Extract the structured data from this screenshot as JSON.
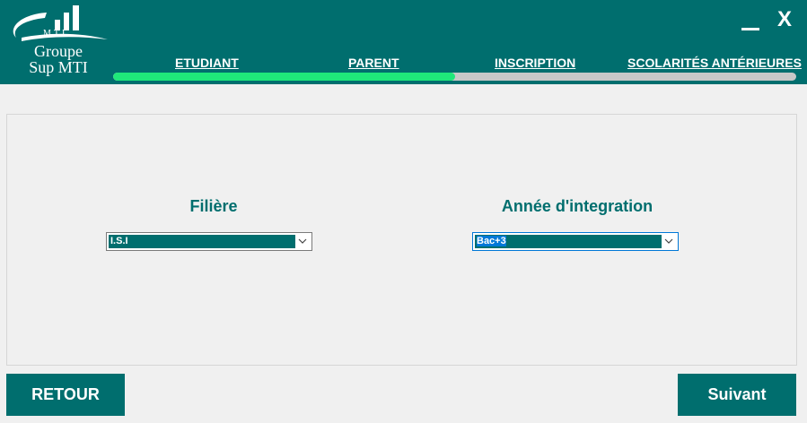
{
  "logo": {
    "line1": "Groupe",
    "line2": "Sup MTI",
    "mark_text": "MTI"
  },
  "window": {
    "close_label": "X"
  },
  "nav": {
    "tabs": [
      {
        "label": "ETUDIANT"
      },
      {
        "label": "PARENT"
      },
      {
        "label": "INSCRIPTION"
      },
      {
        "label": "SCOLARITÉS ANTÉRIEURES"
      }
    ],
    "progress_fraction": 0.5
  },
  "form": {
    "filiere": {
      "label": "Filière",
      "value": "I.S.I"
    },
    "annee": {
      "label": "Année d'integration",
      "value": "Bac+3"
    }
  },
  "buttons": {
    "back": "RETOUR",
    "next": "Suivant"
  },
  "colors": {
    "primary": "#006e6e",
    "progress": "#1fe87a",
    "selection": "#0078d7"
  }
}
